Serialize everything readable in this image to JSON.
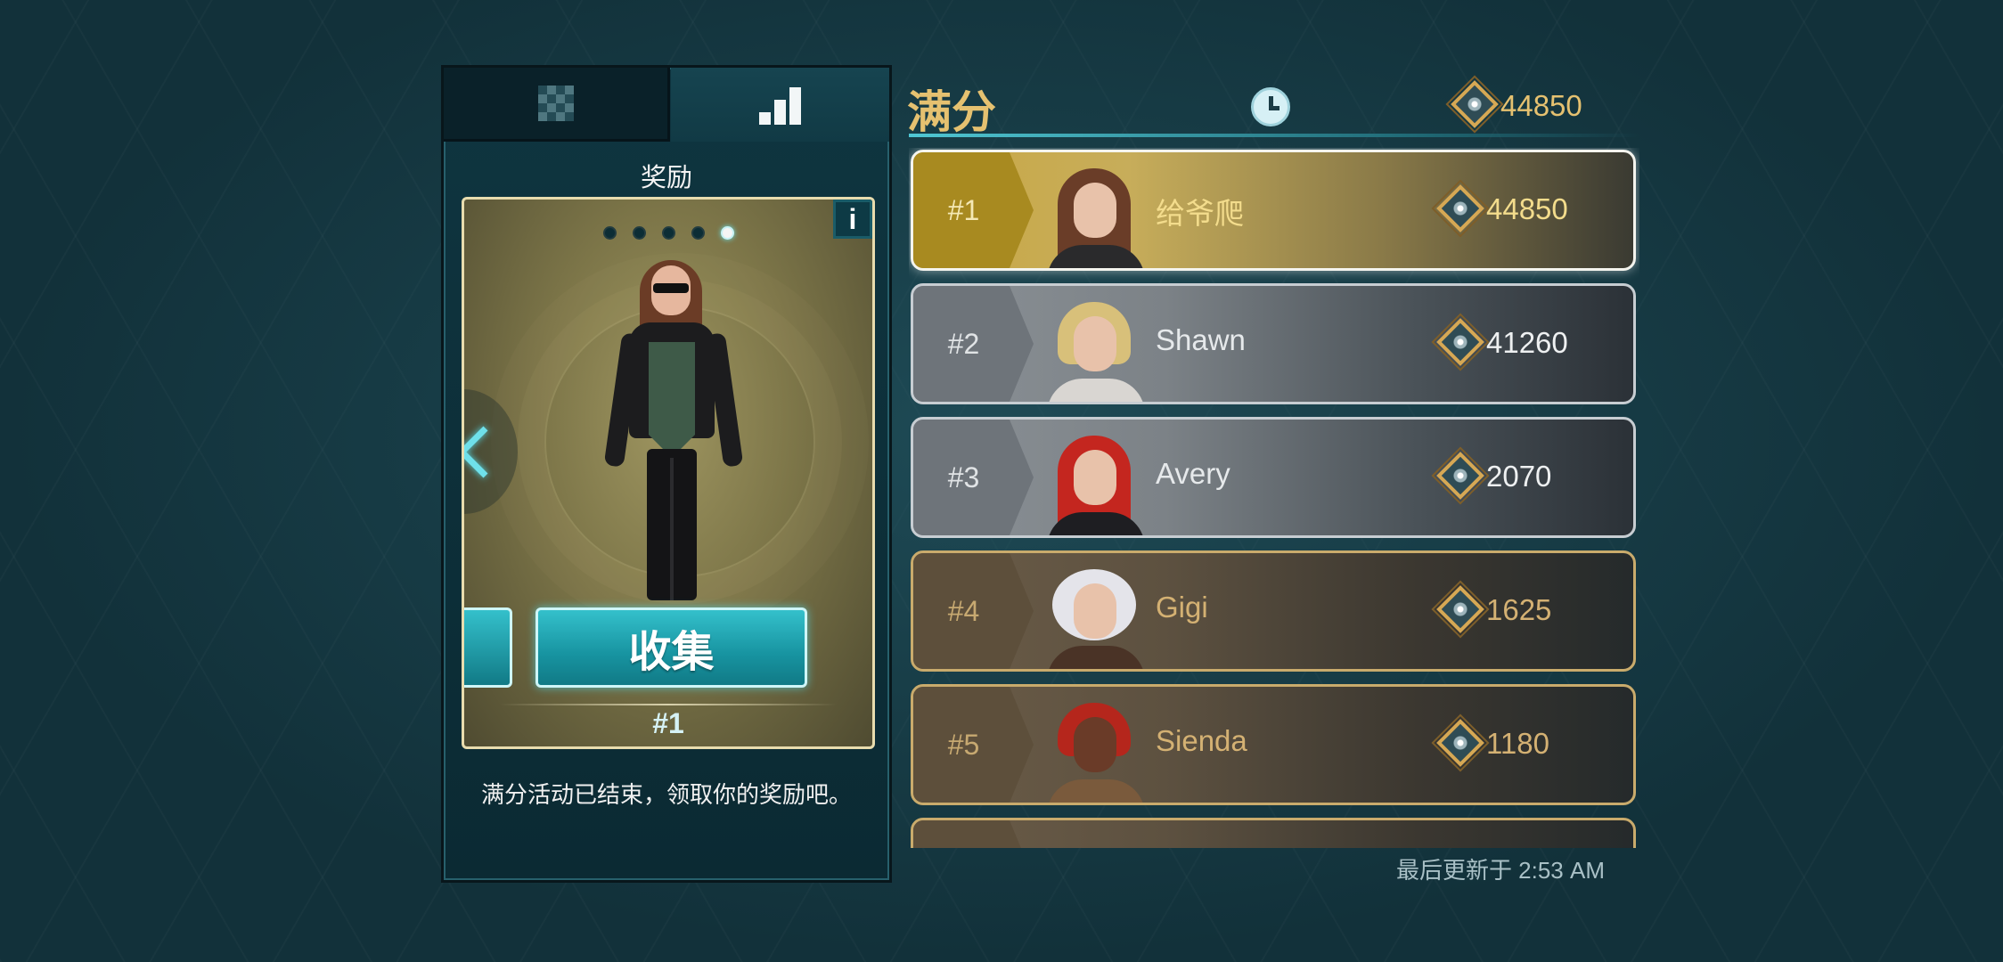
{
  "tabs": [
    {
      "icon": "checker-grid-icon",
      "selected": false
    },
    {
      "icon": "ranking-bars-icon",
      "selected": true
    }
  ],
  "reward_panel": {
    "title": "奖励",
    "carousel_total": 5,
    "carousel_active": 5,
    "info_label": "i",
    "collect_label": "收集",
    "rank_label": "#1",
    "message": "满分活动已结束，领取你的奖励吧。"
  },
  "leaderboard": {
    "title": "满分",
    "header_score": "44850",
    "rows": [
      {
        "rank": "#1",
        "name": "给爷爬",
        "score": "44850",
        "tier": "gold"
      },
      {
        "rank": "#2",
        "name": "Shawn",
        "score": "41260",
        "tier": "silver"
      },
      {
        "rank": "#3",
        "name": "Avery",
        "score": "2070",
        "tier": "silver"
      },
      {
        "rank": "#4",
        "name": "Gigi",
        "score": "1625",
        "tier": "bronze"
      },
      {
        "rank": "#5",
        "name": "Sienda",
        "score": "1180",
        "tier": "bronze"
      }
    ],
    "updated_text": "最后更新于 2:53 AM"
  },
  "colors": {
    "gold_text": "#e5c170",
    "accent_cyan": "#34c0cb"
  }
}
